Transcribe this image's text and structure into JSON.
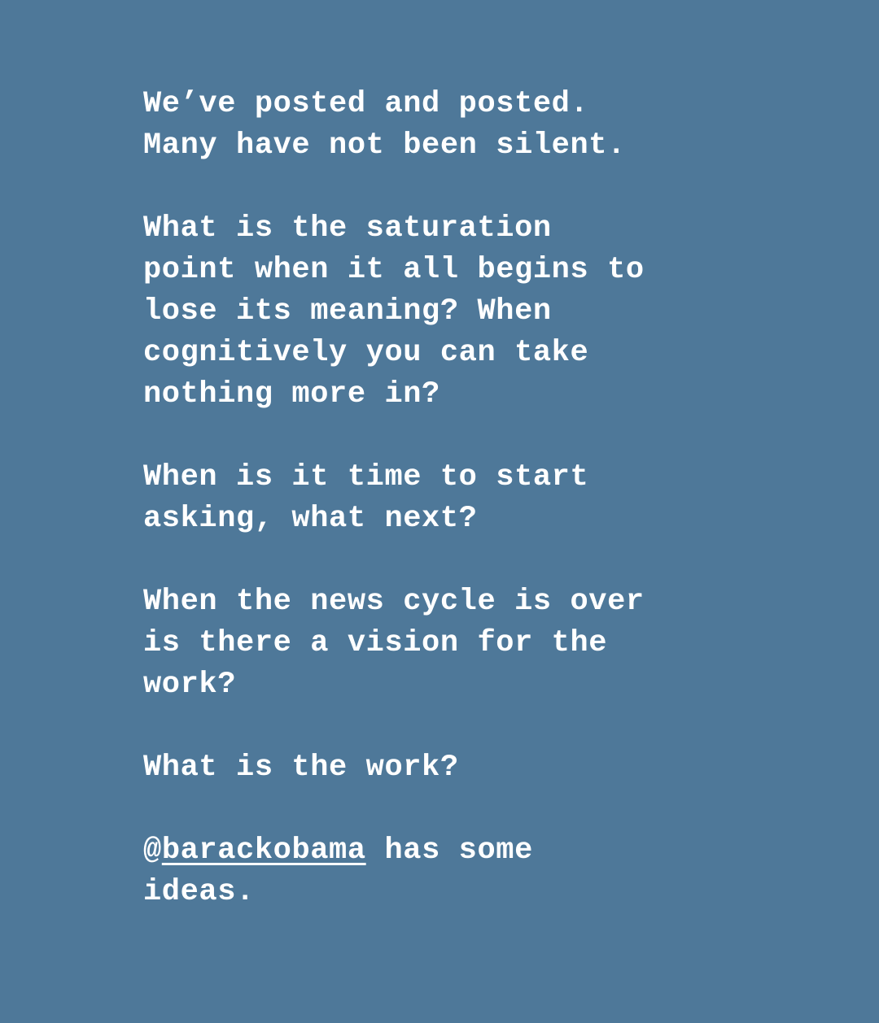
{
  "story": {
    "paragraph_1": {
      "line_1": "We’ve posted and posted.",
      "line_2": "Many have not been silent."
    },
    "paragraph_2": {
      "line_1": "What is the saturation",
      "line_2": "point when it all begins to",
      "line_3": "lose its meaning? When",
      "line_4": "cognitively you can take",
      "line_5": "nothing more in?"
    },
    "paragraph_3": {
      "line_1": "When is it time to start",
      "line_2": "asking, what next?"
    },
    "paragraph_4": {
      "line_1": "When the news cycle is over",
      "line_2": "is there a vision for the",
      "line_3": "work?"
    },
    "paragraph_5": {
      "line_1": "What is the work?"
    },
    "paragraph_6": {
      "at_sign": "@",
      "mention": "barackobama",
      "line_1_rest": " has some",
      "line_2": "ideas."
    }
  },
  "colors": {
    "background": "#4e7899",
    "text": "#ffffff"
  }
}
